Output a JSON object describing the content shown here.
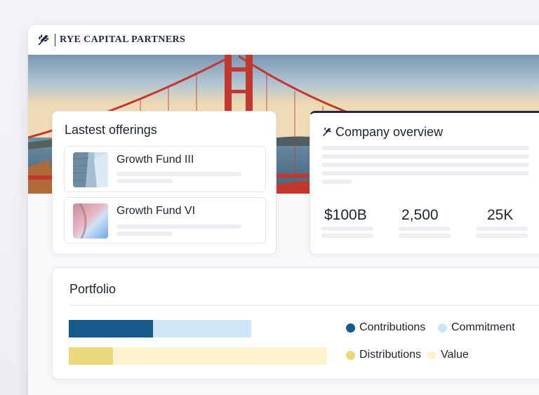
{
  "brand": {
    "name": "RYE CAPITAL PARTNERS"
  },
  "offerings": {
    "title": "Lastest offerings",
    "items": [
      {
        "name": "Growth Fund III"
      },
      {
        "name": "Growth Fund VI"
      }
    ]
  },
  "overview": {
    "title": "Company overview",
    "stats": [
      {
        "value": "$100B"
      },
      {
        "value": "2,500"
      },
      {
        "value": "25K"
      }
    ]
  },
  "portfolio": {
    "title": "Portfolio",
    "bars": [
      {
        "segments": [
          {
            "name": "Contributions",
            "fraction": 0.46,
            "color": "#155a8a"
          },
          {
            "name": "Commitment",
            "fraction": 1.0,
            "color": "#cde6f7"
          }
        ]
      },
      {
        "segments": [
          {
            "name": "Distributions",
            "fraction": 0.17,
            "color": "#ecd97b"
          },
          {
            "name": "Value",
            "fraction": 1.0,
            "color": "#fdf3cf"
          }
        ]
      }
    ],
    "legend": [
      {
        "label": "Contributions",
        "color": "#155a8a"
      },
      {
        "label": "Commitment",
        "color": "#cde6f7"
      },
      {
        "label": "Distributions",
        "color": "#ecd97b"
      },
      {
        "label": "Value",
        "color": "#fdf3cf"
      }
    ]
  }
}
